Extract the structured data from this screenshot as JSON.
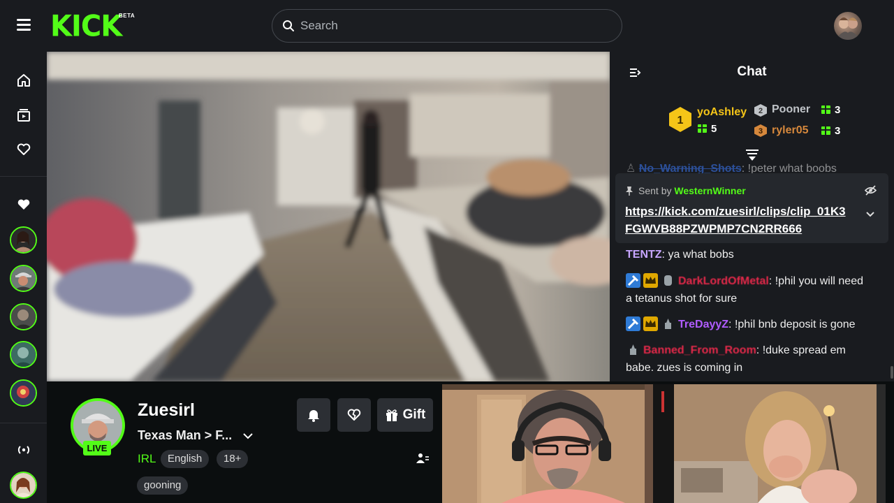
{
  "header": {
    "logo_text": "KICK",
    "beta_label": "BETA",
    "search_placeholder": "Search"
  },
  "sidebar": {
    "icons": [
      "home-icon",
      "following-icon",
      "heart-icon",
      "heart-filled-icon",
      "broadcast-icon"
    ],
    "followed_channels_count": 5
  },
  "chat": {
    "title": "Chat",
    "leaderboard": [
      {
        "rank": "1",
        "name": "yoAshley",
        "gifts": "5",
        "color": "#f5c518"
      },
      {
        "rank": "2",
        "name": "Pooner",
        "gifts": "3",
        "color": "#c0c4c8"
      },
      {
        "rank": "3",
        "name": "ryler05",
        "gifts": "3",
        "color": "#d6883c"
      }
    ],
    "faded_message": {
      "user": "No_Warning_Shots",
      "text": ": !peter what boobs"
    },
    "pinned": {
      "sent_by_label": "Sent by",
      "sender": "WesternWinner",
      "link_line1": "https://kick.com/zuesirl/clips/clip_01K3",
      "link_line2": "FGWVB88PZWPMP7CN2RR666"
    },
    "messages": [
      {
        "user": "TENTZ",
        "user_color": "#c7a6ff",
        "text": ": ya what bobs"
      },
      {
        "user": "DarkLordOfMetal",
        "user_color": "#e5294a",
        "text_line1": ": !phil you will need",
        "text_line2": "a tetanus shot for sure"
      },
      {
        "user": "TreDayyZ",
        "user_color": "#b05cff",
        "text": ": !phil bnb deposit is gone"
      },
      {
        "user": "Banned_From_Room",
        "user_color": "#e5294a",
        "text_line1": ": !duke spread em",
        "text_line2": "babe. zues is coming in"
      }
    ]
  },
  "stream_info": {
    "live_label": "LIVE",
    "streamer_name": "Zuesirl",
    "title": "Texas Man > F...",
    "category": "IRL",
    "tags": [
      "English",
      "18+",
      "gooning"
    ],
    "gift_label": "Gift"
  }
}
